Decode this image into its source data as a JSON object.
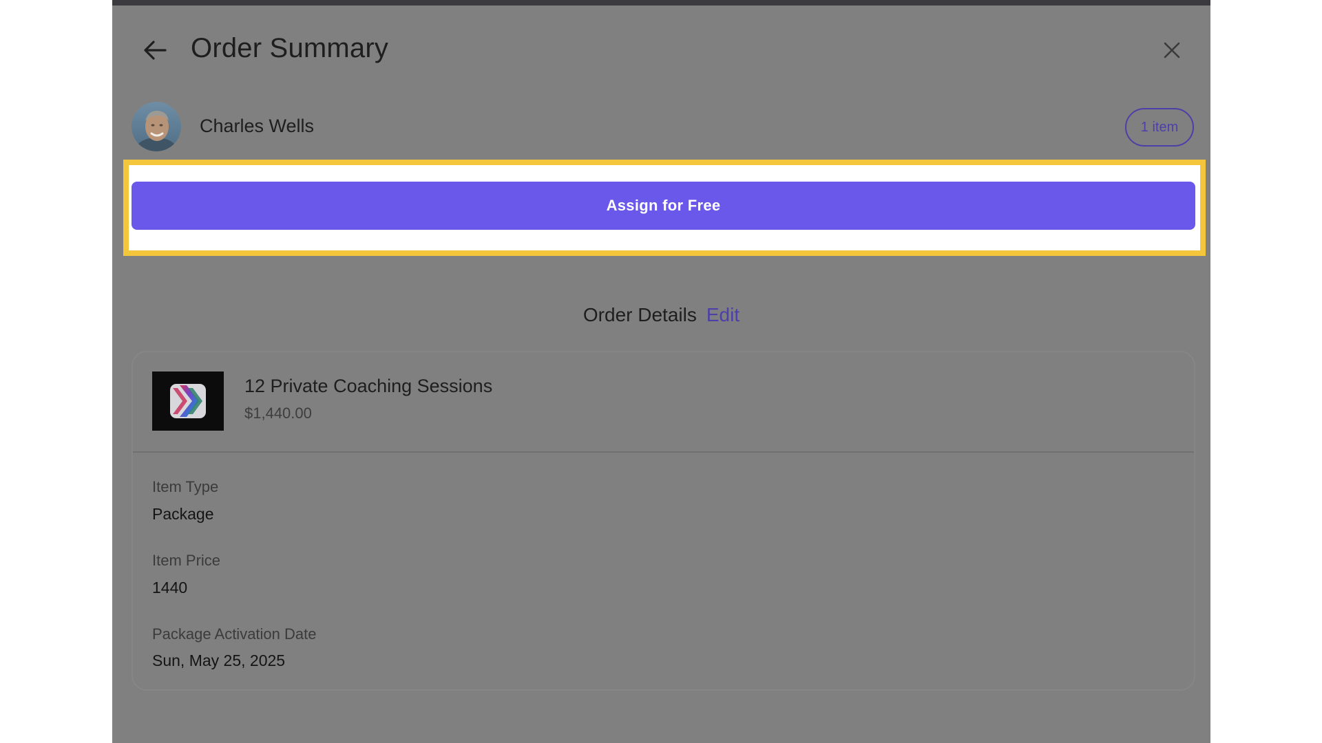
{
  "header": {
    "title": "Order Summary"
  },
  "customer": {
    "name": "Charles Wells",
    "item_badge": "1 item"
  },
  "actions": {
    "assign_label": "Assign for Free"
  },
  "order_details": {
    "heading": "Order Details",
    "edit_label": "Edit"
  },
  "item": {
    "title": "12 Private Coaching Sessions",
    "price": "$1,440.00",
    "fields": [
      {
        "label": "Item Type",
        "value": "Package"
      },
      {
        "label": "Item Price",
        "value": "1440"
      },
      {
        "label": "Package Activation Date",
        "value": "Sun, May 25, 2025"
      }
    ]
  },
  "colors": {
    "overlay": "#808080",
    "accent": "#6a58ea",
    "highlight_border": "#f4c63c"
  },
  "icons": {
    "back": "arrow-left-icon",
    "close": "close-icon"
  }
}
